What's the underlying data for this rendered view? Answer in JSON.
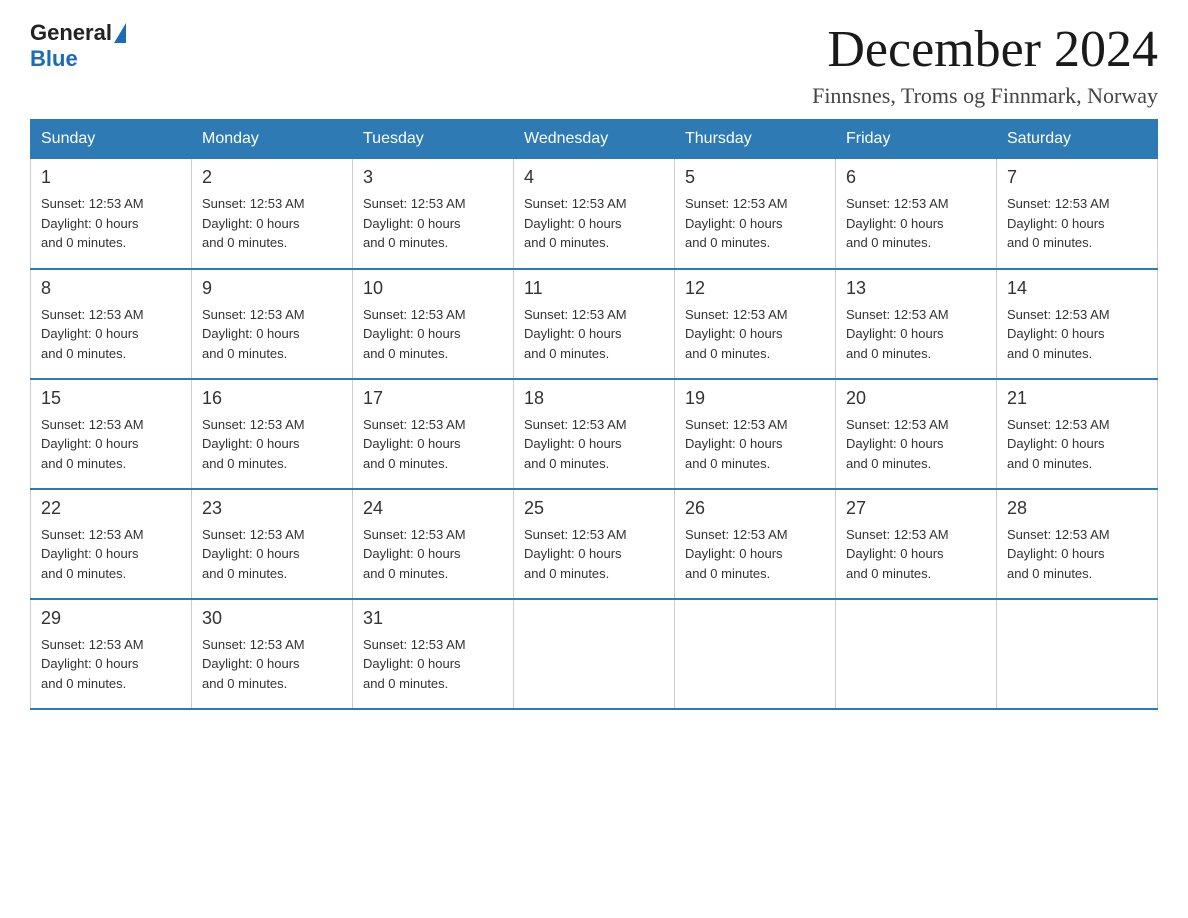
{
  "header": {
    "logo_general": "General",
    "logo_blue": "Blue",
    "title": "December 2024",
    "subtitle": "Finnsnes, Troms og Finnmark, Norway"
  },
  "weekdays": [
    "Sunday",
    "Monday",
    "Tuesday",
    "Wednesday",
    "Thursday",
    "Friday",
    "Saturday"
  ],
  "weeks": [
    [
      {
        "day": "1",
        "info": "Sunset: 12:53 AM\nDaylight: 0 hours\nand 0 minutes."
      },
      {
        "day": "2",
        "info": "Sunset: 12:53 AM\nDaylight: 0 hours\nand 0 minutes."
      },
      {
        "day": "3",
        "info": "Sunset: 12:53 AM\nDaylight: 0 hours\nand 0 minutes."
      },
      {
        "day": "4",
        "info": "Sunset: 12:53 AM\nDaylight: 0 hours\nand 0 minutes."
      },
      {
        "day": "5",
        "info": "Sunset: 12:53 AM\nDaylight: 0 hours\nand 0 minutes."
      },
      {
        "day": "6",
        "info": "Sunset: 12:53 AM\nDaylight: 0 hours\nand 0 minutes."
      },
      {
        "day": "7",
        "info": "Sunset: 12:53 AM\nDaylight: 0 hours\nand 0 minutes."
      }
    ],
    [
      {
        "day": "8",
        "info": "Sunset: 12:53 AM\nDaylight: 0 hours\nand 0 minutes."
      },
      {
        "day": "9",
        "info": "Sunset: 12:53 AM\nDaylight: 0 hours\nand 0 minutes."
      },
      {
        "day": "10",
        "info": "Sunset: 12:53 AM\nDaylight: 0 hours\nand 0 minutes."
      },
      {
        "day": "11",
        "info": "Sunset: 12:53 AM\nDaylight: 0 hours\nand 0 minutes."
      },
      {
        "day": "12",
        "info": "Sunset: 12:53 AM\nDaylight: 0 hours\nand 0 minutes."
      },
      {
        "day": "13",
        "info": "Sunset: 12:53 AM\nDaylight: 0 hours\nand 0 minutes."
      },
      {
        "day": "14",
        "info": "Sunset: 12:53 AM\nDaylight: 0 hours\nand 0 minutes."
      }
    ],
    [
      {
        "day": "15",
        "info": "Sunset: 12:53 AM\nDaylight: 0 hours\nand 0 minutes."
      },
      {
        "day": "16",
        "info": "Sunset: 12:53 AM\nDaylight: 0 hours\nand 0 minutes."
      },
      {
        "day": "17",
        "info": "Sunset: 12:53 AM\nDaylight: 0 hours\nand 0 minutes."
      },
      {
        "day": "18",
        "info": "Sunset: 12:53 AM\nDaylight: 0 hours\nand 0 minutes."
      },
      {
        "day": "19",
        "info": "Sunset: 12:53 AM\nDaylight: 0 hours\nand 0 minutes."
      },
      {
        "day": "20",
        "info": "Sunset: 12:53 AM\nDaylight: 0 hours\nand 0 minutes."
      },
      {
        "day": "21",
        "info": "Sunset: 12:53 AM\nDaylight: 0 hours\nand 0 minutes."
      }
    ],
    [
      {
        "day": "22",
        "info": "Sunset: 12:53 AM\nDaylight: 0 hours\nand 0 minutes."
      },
      {
        "day": "23",
        "info": "Sunset: 12:53 AM\nDaylight: 0 hours\nand 0 minutes."
      },
      {
        "day": "24",
        "info": "Sunset: 12:53 AM\nDaylight: 0 hours\nand 0 minutes."
      },
      {
        "day": "25",
        "info": "Sunset: 12:53 AM\nDaylight: 0 hours\nand 0 minutes."
      },
      {
        "day": "26",
        "info": "Sunset: 12:53 AM\nDaylight: 0 hours\nand 0 minutes."
      },
      {
        "day": "27",
        "info": "Sunset: 12:53 AM\nDaylight: 0 hours\nand 0 minutes."
      },
      {
        "day": "28",
        "info": "Sunset: 12:53 AM\nDaylight: 0 hours\nand 0 minutes."
      }
    ],
    [
      {
        "day": "29",
        "info": "Sunset: 12:53 AM\nDaylight: 0 hours\nand 0 minutes."
      },
      {
        "day": "30",
        "info": "Sunset: 12:53 AM\nDaylight: 0 hours\nand 0 minutes."
      },
      {
        "day": "31",
        "info": "Sunset: 12:53 AM\nDaylight: 0 hours\nand 0 minutes."
      },
      {
        "day": "",
        "info": ""
      },
      {
        "day": "",
        "info": ""
      },
      {
        "day": "",
        "info": ""
      },
      {
        "day": "",
        "info": ""
      }
    ]
  ],
  "colors": {
    "header_bg": "#2d7ab5",
    "header_text": "#ffffff",
    "border": "#cccccc",
    "accent": "#1a6db5"
  }
}
